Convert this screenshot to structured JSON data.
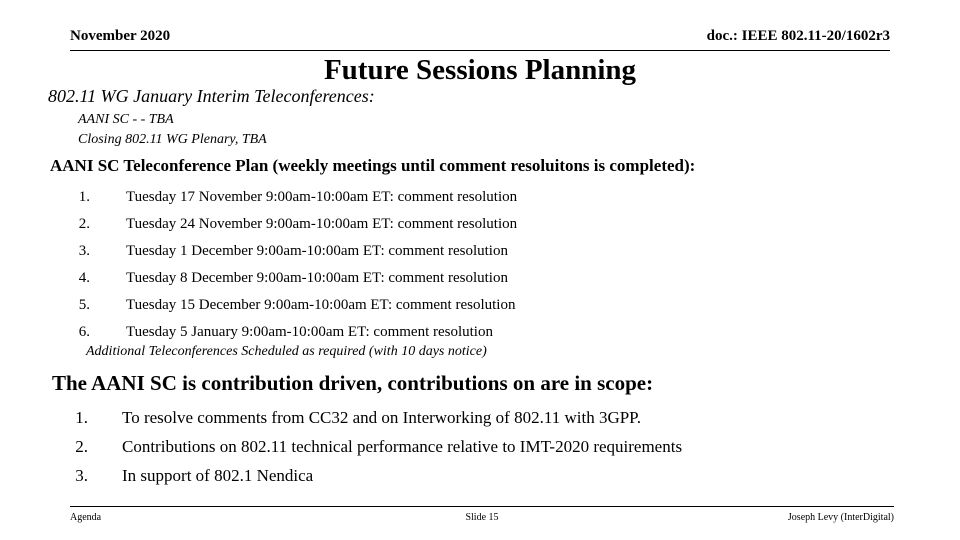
{
  "header": {
    "date": "November 2020",
    "doc": "doc.: IEEE 802.11-20/1602r3"
  },
  "title": "Future Sessions Planning",
  "subtitle": "802.11 WG January Interim Teleconferences:",
  "sub_lines": [
    "AANI SC -  -  TBA",
    "Closing 802.11 WG Plenary, TBA"
  ],
  "heading_1": "AANI SC Teleconference Plan (weekly meetings until comment resoluitons is completed):",
  "teleconference_list": [
    {
      "num": "1.",
      "text": "Tuesday 17 November 9:00am-10:00am ET:  comment resolution"
    },
    {
      "num": "2.",
      "text": "Tuesday 24 November 9:00am-10:00am ET:  comment resolution"
    },
    {
      "num": "3.",
      "text": "Tuesday 1 December 9:00am-10:00am ET:  comment resolution"
    },
    {
      "num": "4.",
      "text": "Tuesday 8 December 9:00am-10:00am ET:  comment resolution"
    },
    {
      "num": "5.",
      "text": "Tuesday 15 December 9:00am-10:00am ET:  comment resolution"
    },
    {
      "num": "6.",
      "text": "Tuesday 5 January 9:00am-10:00am ET:  comment resolution"
    }
  ],
  "note": "Additional Teleconferences Scheduled as required (with 10 days notice)",
  "heading_2": "The AANI SC is contribution driven, contributions on are in scope:",
  "scope_list": [
    {
      "num": "1.",
      "text": "To resolve comments from CC32 and on Interworking of 802.11 with 3GPP."
    },
    {
      "num": "2.",
      "text": "Contributions on 802.11 technical performance relative to IMT-2020 requirements"
    },
    {
      "num": "3.",
      "text": "In support of 802.1 Nendica"
    }
  ],
  "footer": {
    "left": "Agenda",
    "center": "Slide 15",
    "right": "Joseph Levy (InterDigital)"
  }
}
